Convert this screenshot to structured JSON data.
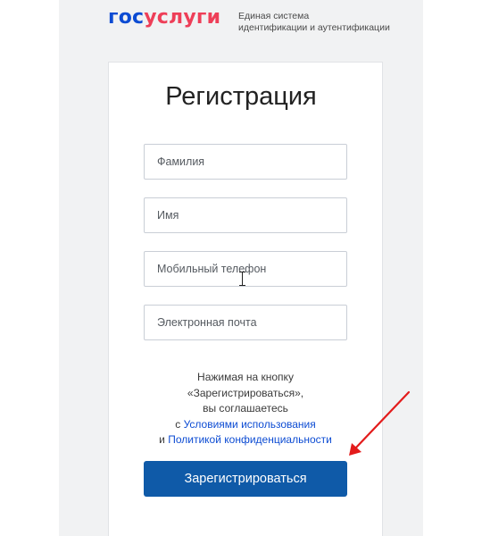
{
  "header": {
    "logo_part1": "гос",
    "logo_part2": "услуги",
    "tagline_line1": "Единая система",
    "tagline_line2": "идентификации и аутентификации"
  },
  "form": {
    "title": "Регистрация",
    "fields": [
      {
        "placeholder": "Фамилия",
        "value": ""
      },
      {
        "placeholder": "Имя",
        "value": ""
      },
      {
        "placeholder": "Мобильный телефон",
        "value": ""
      },
      {
        "placeholder": "Электронная почта",
        "value": ""
      }
    ],
    "agreement": {
      "line1": "Нажимая на кнопку",
      "line2": "«Зарегистрироваться»,",
      "line3": "вы соглашаетесь",
      "line4_prefix": "с ",
      "terms_link": "Условиями использования",
      "line5_prefix": "и ",
      "privacy_link": "Политикой конфиденциальности"
    },
    "submit_label": "Зарегистрироваться"
  },
  "colors": {
    "brand_blue": "#0d4cd3",
    "brand_red": "#ee3f58",
    "button_blue": "#0f5aa8",
    "annotation_arrow": "#e31b1b"
  },
  "icons": [
    "text-cursor-icon",
    "annotation-arrow-icon"
  ]
}
